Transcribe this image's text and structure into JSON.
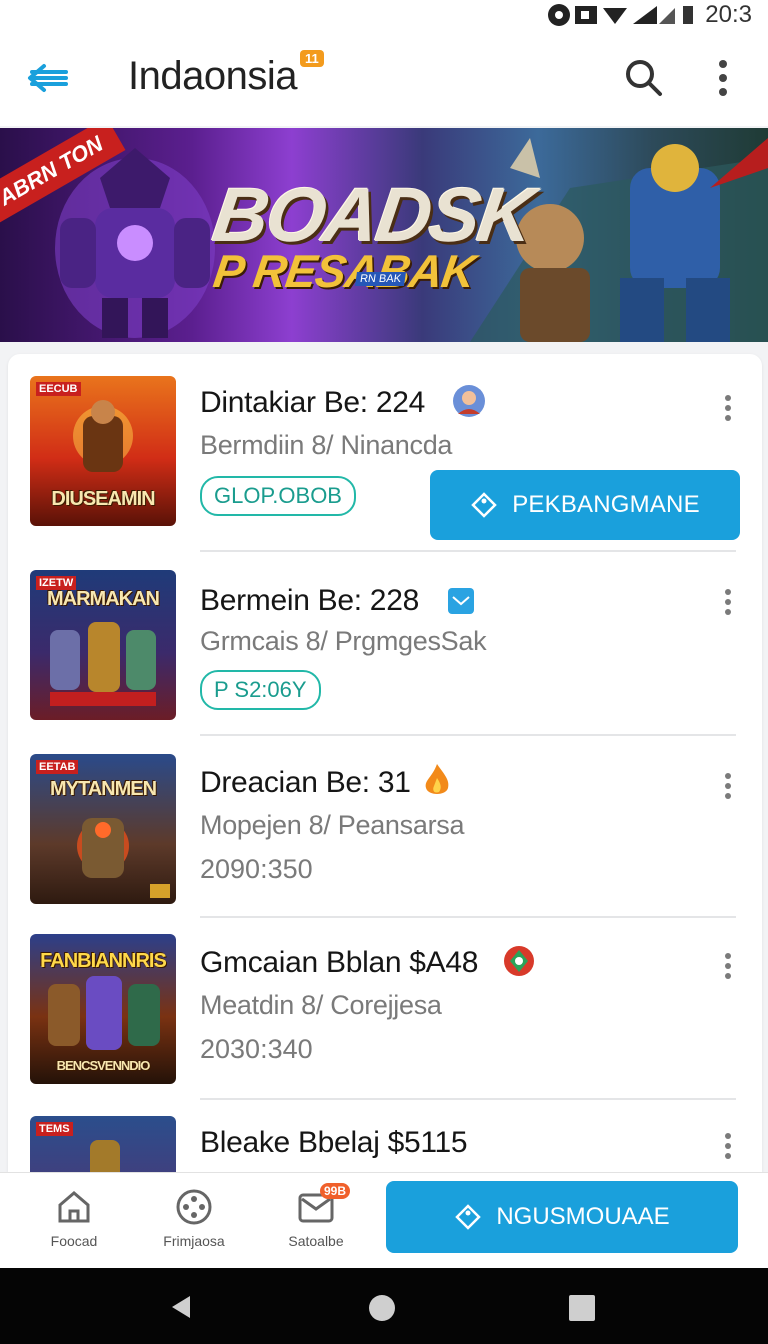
{
  "status_bar": {
    "time": "20:3"
  },
  "app_bar": {
    "title": "Indaonsia",
    "badge": "11"
  },
  "banner": {
    "ribbon": "ABRN TON",
    "headline": "BOADSK",
    "subheadline": "P RESABAK",
    "tag": "RN BAK"
  },
  "list": [
    {
      "thumb_label": "EECUB",
      "thumb_title": "DIUSEAMIN",
      "name": "Dintakiar Be: 224",
      "sub": "Bermdiin 8/ Ninancda",
      "chip": "GLOP.OBOB",
      "cta": "PEKBANGMANE"
    },
    {
      "thumb_label": "IZETW",
      "thumb_title": "MARMAKAN",
      "name": "Bermein Be: 228",
      "sub": "Grmcais 8/ PrgmgesSak",
      "chip": "P S2:06Y"
    },
    {
      "thumb_label": "EETAB",
      "thumb_title": "MYTANMEN",
      "name": "Dreacian Be: 31",
      "sub": "Mopejen 8/ Peansarsa",
      "meta": "2090:350"
    },
    {
      "thumb_label": "",
      "thumb_title": "FANBIANNRIS",
      "thumb_footer": "BENCSVENNDIO",
      "name": "Gmcaian Bblan $A48",
      "sub": "Meatdin 8/ Corejjesa",
      "meta": "2030:340"
    },
    {
      "thumb_label": "TEMS",
      "thumb_title": "",
      "name": "Bleake Bbelaj $5115"
    }
  ],
  "bottom_nav": {
    "items": [
      {
        "label": "Foocad"
      },
      {
        "label": "Frimjaosa"
      },
      {
        "label": "Satoalbe",
        "badge": "99B"
      }
    ],
    "cta": "NGUSMOUAAE"
  },
  "colors": {
    "accent": "#1aa0dc",
    "chip": "#22b8a8"
  }
}
